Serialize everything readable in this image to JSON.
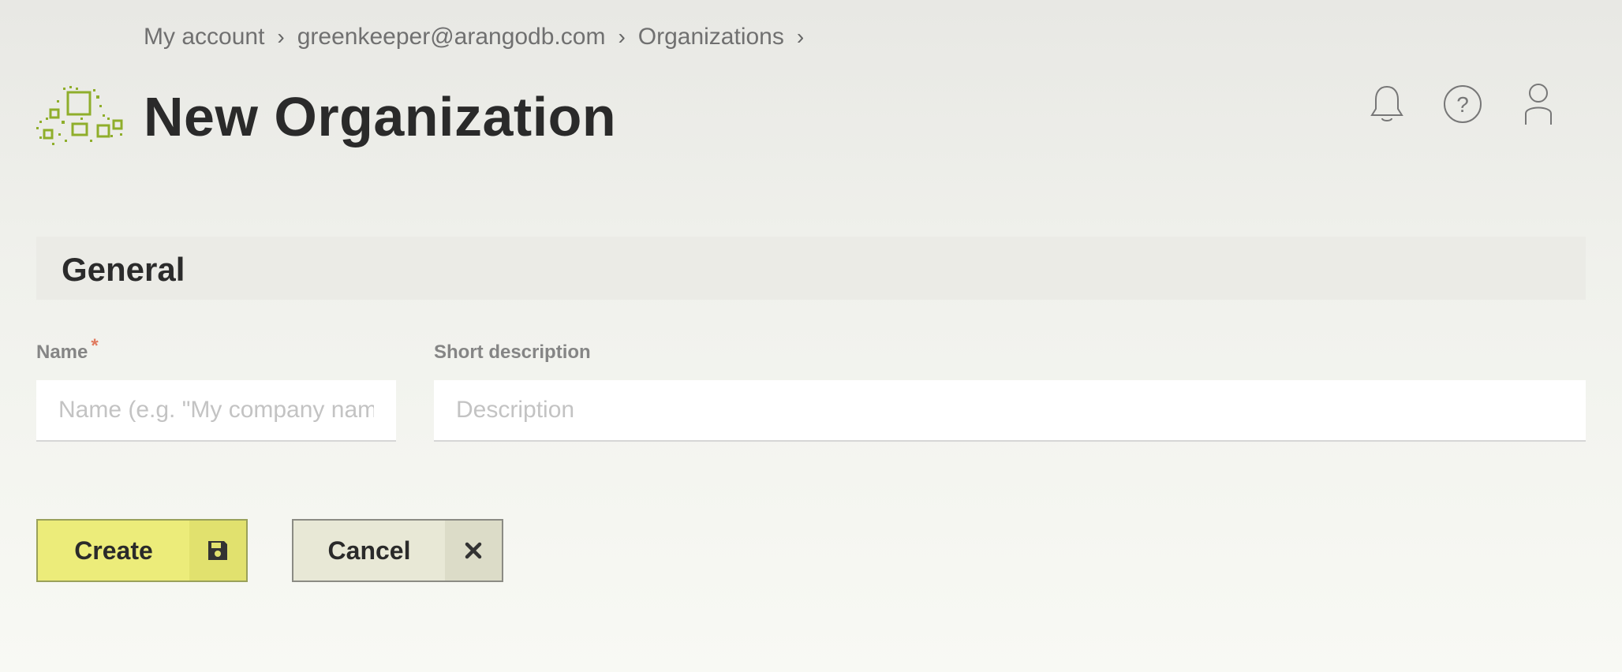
{
  "breadcrumb": {
    "items": [
      "My account",
      "greenkeeper@arangodb.com",
      "Organizations"
    ],
    "separator": "›"
  },
  "header": {
    "title": "New Organization",
    "logo_icon": "arangodb-logo-icon"
  },
  "top_icons": [
    "bell-icon",
    "help-icon",
    "user-icon"
  ],
  "section": {
    "title": "General"
  },
  "form": {
    "name": {
      "label": "Name",
      "required_mark": "*",
      "value": "",
      "placeholder": "Name (e.g. \"My company name\")"
    },
    "description": {
      "label": "Short description",
      "value": "",
      "placeholder": "Description"
    }
  },
  "buttons": {
    "create": {
      "label": "Create",
      "icon": "save-icon"
    },
    "cancel": {
      "label": "Cancel",
      "icon": "close-icon"
    }
  },
  "colors": {
    "accent": "#ecec7a",
    "logo_green": "#8fae2b",
    "required": "#e07a5f"
  }
}
